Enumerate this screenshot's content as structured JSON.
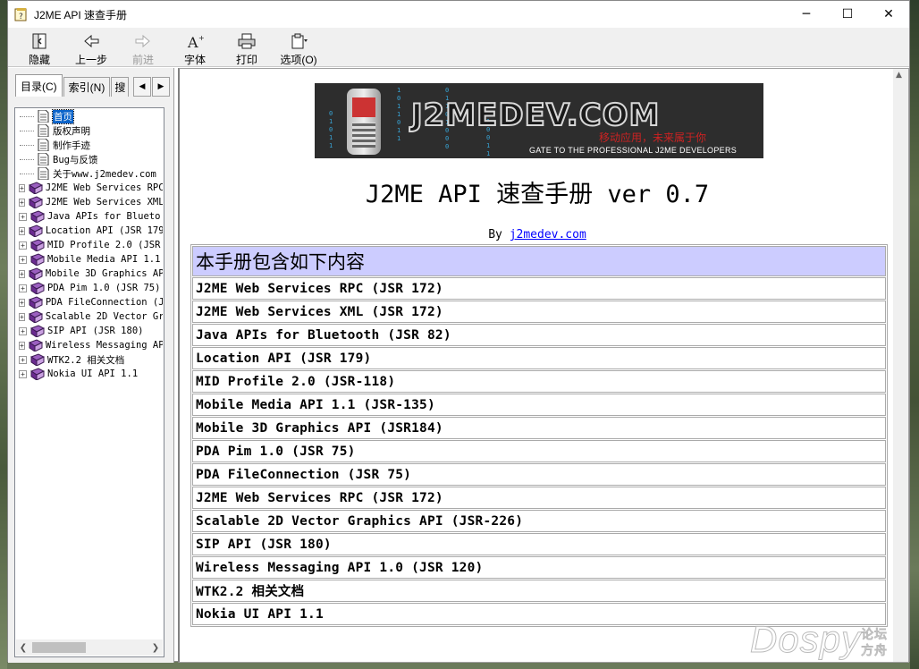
{
  "window": {
    "title": "J2ME API 速查手册",
    "minimize": "─",
    "maximize": "☐",
    "close": "✕"
  },
  "toolbar": {
    "hide": "隐藏",
    "back": "上一步",
    "forward": "前进",
    "font": "字体",
    "print": "打印",
    "options": "选项(O)"
  },
  "tabs": {
    "contents": "目录(C)",
    "index": "索引(N)",
    "search": "搜"
  },
  "tree": [
    {
      "label": "首页",
      "type": "page",
      "selected": true
    },
    {
      "label": "版权声明",
      "type": "page"
    },
    {
      "label": "制作手迹",
      "type": "page"
    },
    {
      "label": "Bug与反馈",
      "type": "page"
    },
    {
      "label": "关于www.j2medev.com",
      "type": "page"
    },
    {
      "label": "J2ME Web Services RPC",
      "type": "book"
    },
    {
      "label": "J2ME Web Services XML",
      "type": "book"
    },
    {
      "label": "Java APIs for Blueto",
      "type": "book"
    },
    {
      "label": "Location API (JSR 179",
      "type": "book"
    },
    {
      "label": "MID Profile 2.0  (JSR",
      "type": "book"
    },
    {
      "label": "Mobile Media API 1.1",
      "type": "book"
    },
    {
      "label": "Mobile 3D Graphics AP",
      "type": "book"
    },
    {
      "label": "PDA Pim 1.0 (JSR 75)",
      "type": "book"
    },
    {
      "label": "PDA FileConnection (J",
      "type": "book"
    },
    {
      "label": "Scalable 2D Vector Gr",
      "type": "book"
    },
    {
      "label": "SIP API (JSR 180)",
      "type": "book"
    },
    {
      "label": "Wireless Messaging AP",
      "type": "book"
    },
    {
      "label": "WTK2.2 相关文档",
      "type": "book"
    },
    {
      "label": "Nokia UI API 1.1",
      "type": "book"
    }
  ],
  "banner": {
    "logo": "J2MEDEV.COM",
    "slogan": "移动应用，未来属于你",
    "tagline": "GATE TO THE PROFESSIONAL J2ME DEVELOPERS",
    "bits1": "01011",
    "bits2": "1011011",
    "bits3": "01101000",
    "bits4": "0100111"
  },
  "page": {
    "title": "J2ME API 速查手册 ver 0.7",
    "by_prefix": "By ",
    "by_link": "j2medev.com",
    "table_header": "本手册包含如下内容",
    "rows": [
      "J2ME Web Services RPC (JSR 172)",
      "J2ME Web Services XML (JSR 172)",
      "Java APIs for Bluetooth (JSR 82)",
      "Location API (JSR 179)",
      "MID Profile 2.0 (JSR-118)",
      "Mobile Media API 1.1 (JSR-135)",
      "Mobile 3D Graphics API (JSR184)",
      "PDA Pim 1.0 (JSR 75)",
      "PDA FileConnection (JSR 75)",
      "J2ME Web Services RPC (JSR 172)",
      "Scalable 2D Vector Graphics API (JSR-226)",
      "SIP API (JSR 180)",
      "Wireless Messaging API 1.0 (JSR 120)",
      "WTK2.2 相关文档",
      "Nokia UI API 1.1"
    ]
  },
  "watermark": {
    "brand": "Dospy",
    "sub": "论坛方舟"
  },
  "colors": {
    "table_header_bg": "#ccccff",
    "link": "#0000ff",
    "selection": "#0a63c9"
  }
}
